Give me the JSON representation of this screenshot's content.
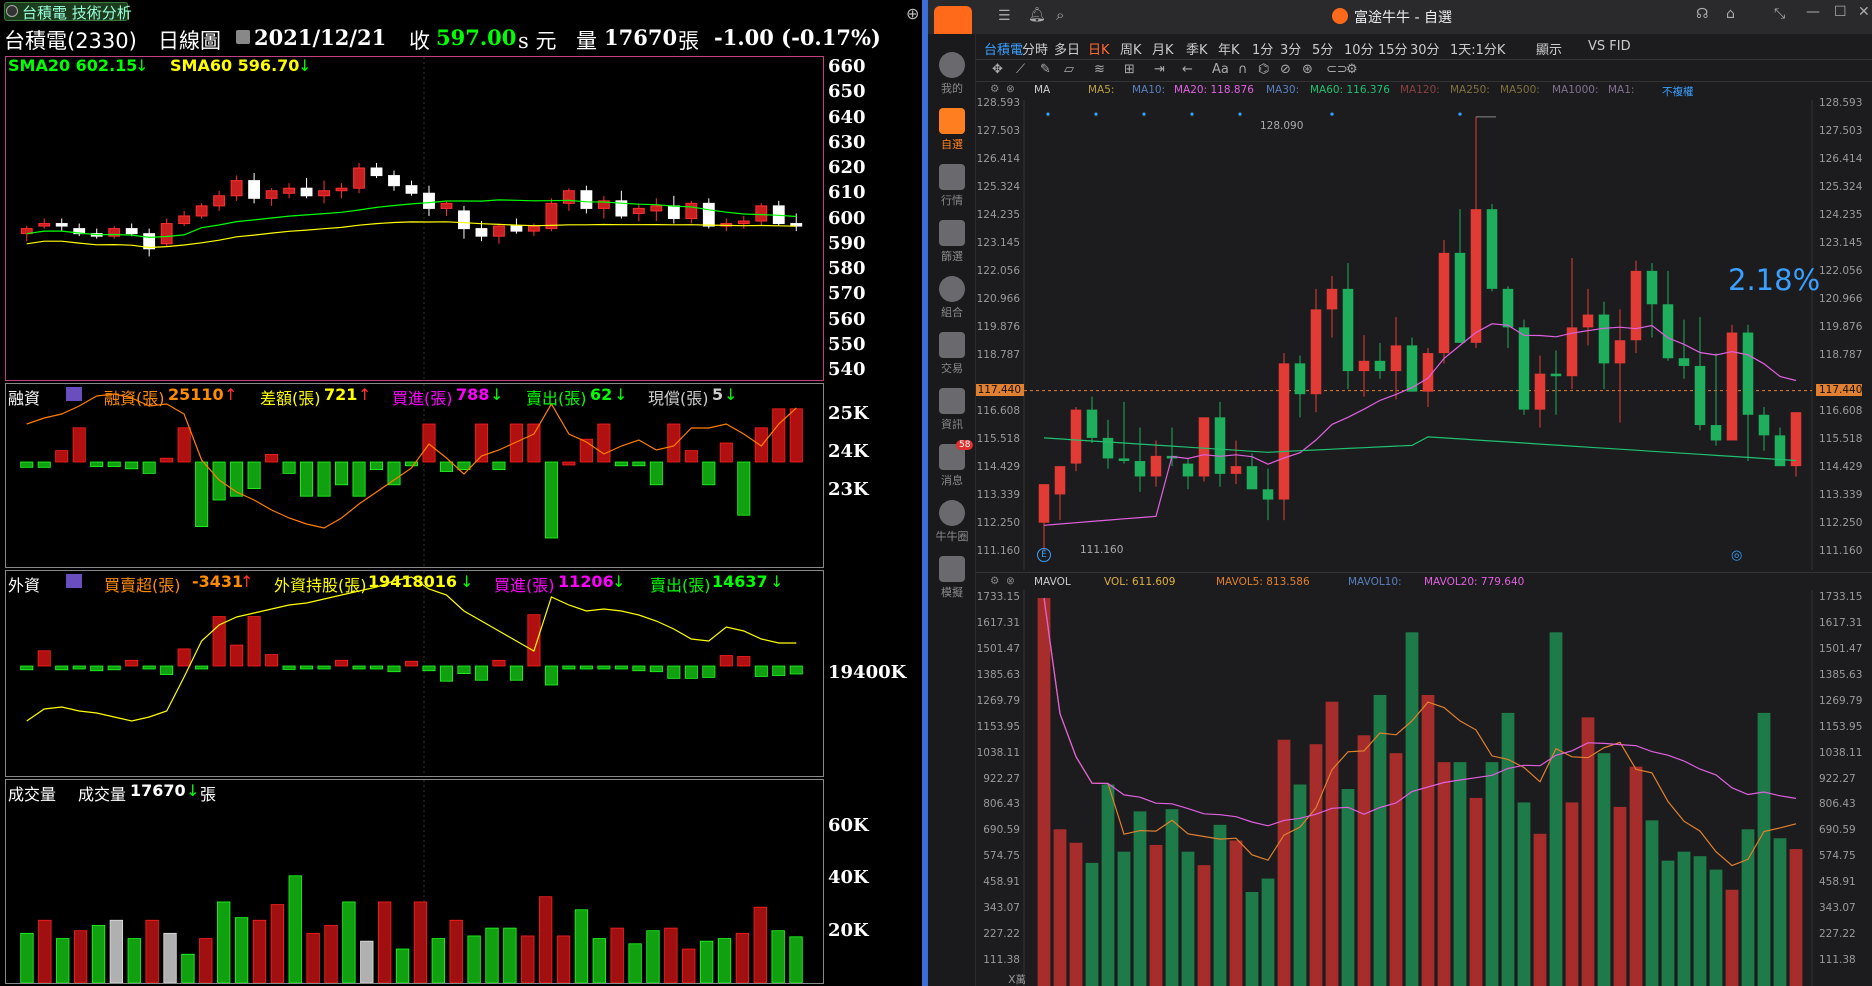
{
  "left": {
    "tab_title": "台積電 技術分析",
    "header": {
      "stock": "台積電(2330)",
      "period": "日線圖",
      "date": "2021/12/21",
      "close_label": "收",
      "close": "597.00",
      "close_unit": "s 元",
      "vol_label": "量",
      "vol": "17670",
      "vol_unit": "張",
      "change": "-1.00 (-0.17%)"
    },
    "price_panel": {
      "sma20": "SMA20 602.15",
      "sma60": "SMA60 596.70",
      "yticks": [
        "660",
        "650",
        "640",
        "630",
        "620",
        "610",
        "600",
        "590",
        "580",
        "570",
        "560",
        "550",
        "540"
      ]
    },
    "margin_panel": {
      "title": "融資",
      "f1l": "融資(張)",
      "f1v": "25110",
      "f2l": "差額(張)",
      "f2v": "721",
      "f3l": "買進(張)",
      "f3v": "788",
      "f4l": "賣出(張)",
      "f4v": "62",
      "f5l": "現償(張)",
      "f5v": "5",
      "yticks": [
        "25K",
        "24K",
        "23K"
      ]
    },
    "foreign_panel": {
      "title": "外資",
      "f1l": "買賣超(張)",
      "f1v": "-3431",
      "f2l": "外資持股(張)",
      "f2v": "19418016",
      "f3l": "買進(張)",
      "f3v": "11206",
      "f4l": "賣出(張)",
      "f4v": "14637",
      "ytick": "19400K"
    },
    "volume_panel": {
      "title": "成交量",
      "vol_label": "成交量",
      "vol_value": "17670",
      "vol_unit": "張",
      "yticks": [
        "60K",
        "40K",
        "20K"
      ]
    }
  },
  "right": {
    "window_title": "富途牛牛 - 自選",
    "sidebar": [
      {
        "label": "我的",
        "icon": "user-icon"
      },
      {
        "label": "自選",
        "icon": "watchlist-icon"
      },
      {
        "label": "行情",
        "icon": "market-icon"
      },
      {
        "label": "篩選",
        "icon": "filter-icon"
      },
      {
        "label": "組合",
        "icon": "portfolio-icon"
      },
      {
        "label": "交易",
        "icon": "trade-icon"
      },
      {
        "label": "資訊",
        "icon": "news-icon"
      },
      {
        "label": "消息",
        "icon": "message-icon",
        "badge": "58"
      },
      {
        "label": "牛牛圈",
        "icon": "community-icon"
      },
      {
        "label": "模擬",
        "icon": "simulate-icon"
      }
    ],
    "tabs": [
      "台積電",
      "分時",
      "多日",
      "日K",
      "周K",
      "月K",
      "季K",
      "年K",
      "1分",
      "3分",
      "5分",
      "10分",
      "15分",
      "30分",
      "1天:1分K",
      "顯示",
      "VS FID"
    ],
    "ma_bar": {
      "ma": "MA",
      "ma5": "MA5:",
      "ma10": "MA10:",
      "ma20": "MA20: 118.876",
      "ma30": "MA30:",
      "ma60": "MA60: 116.376",
      "ma120": "MA120:",
      "ma250": "MA250:",
      "ma500": "MA500:",
      "ma1000": "MA1000:",
      "ma1": "MA1:",
      "adj": "不複權"
    },
    "price_yticks": [
      "128.593",
      "127.503",
      "126.414",
      "125.324",
      "124.235",
      "123.145",
      "122.056",
      "120.966",
      "119.876",
      "118.787",
      "117.440",
      "116.608",
      "115.518",
      "114.429",
      "113.339",
      "112.250",
      "111.160"
    ],
    "current_price": "117.440",
    "high_label": "128.090",
    "low_label": "111.160",
    "percent": "2.18%",
    "vol_bar": {
      "label": "MAVOL",
      "vol": "VOL: 611.609",
      "mavol5": "MAVOL5: 813.586",
      "mavol10": "MAVOL10:",
      "mavol20": "MAVOL20: 779.640"
    },
    "vol_yticks": [
      "1733.15",
      "1617.31",
      "1501.47",
      "1385.63",
      "1269.79",
      "1153.95",
      "1038.11",
      "922.27",
      "806.43",
      "690.59",
      "574.75",
      "458.91",
      "343.07",
      "227.22",
      "111.38"
    ],
    "vol_unit": "X萬"
  },
  "colors": {
    "up_red": "#c0302b",
    "down_green": "#1f9a54",
    "sma20": "#00ff00",
    "sma60": "#ffff00",
    "accent_blue": "#3aa0ff"
  },
  "chart_data": [
    {
      "type": "candlestick",
      "title": "台積電 技術分析 日線圖",
      "ylim": [
        540,
        660
      ],
      "series": [
        {
          "name": "SMA20",
          "last": 602.15
        },
        {
          "name": "SMA60",
          "last": 596.7
        }
      ],
      "ohlc": [
        [
          594,
          597,
          591,
          596
        ],
        [
          597,
          600,
          596,
          598
        ],
        [
          598,
          600,
          595,
          597
        ],
        [
          596,
          598,
          593,
          594
        ],
        [
          594,
          596,
          592,
          593
        ],
        [
          593,
          597,
          592,
          596
        ],
        [
          596,
          598,
          593,
          594
        ],
        [
          594,
          596,
          585,
          588
        ],
        [
          590,
          600,
          589,
          598
        ],
        [
          598,
          603,
          597,
          601
        ],
        [
          601,
          606,
          600,
          605
        ],
        [
          605,
          611,
          603,
          609
        ],
        [
          609,
          617,
          607,
          615
        ],
        [
          615,
          618,
          606,
          608
        ],
        [
          608,
          612,
          605,
          611
        ],
        [
          610,
          614,
          608,
          612
        ],
        [
          612,
          616,
          608,
          609
        ],
        [
          609,
          615,
          606,
          611
        ],
        [
          611,
          614,
          608,
          612
        ],
        [
          612,
          622,
          610,
          620
        ],
        [
          620,
          622,
          616,
          617
        ],
        [
          617,
          619,
          611,
          613
        ],
        [
          613,
          615,
          609,
          610
        ],
        [
          610,
          613,
          601,
          604
        ],
        [
          604,
          607,
          601,
          606
        ],
        [
          603,
          605,
          592,
          596
        ],
        [
          596,
          599,
          591,
          593
        ],
        [
          593,
          598,
          590,
          597
        ],
        [
          597,
          600,
          594,
          595
        ],
        [
          595,
          598,
          593,
          597
        ],
        [
          596,
          608,
          595,
          606
        ],
        [
          606,
          612,
          603,
          611
        ],
        [
          611,
          613,
          602,
          604
        ],
        [
          604,
          609,
          600,
          607
        ],
        [
          607,
          611,
          600,
          601
        ],
        [
          602,
          606,
          599,
          604
        ],
        [
          603,
          608,
          599,
          605
        ],
        [
          605,
          609,
          598,
          600
        ],
        [
          600,
          607,
          598,
          606
        ],
        [
          606,
          608,
          596,
          597
        ],
        [
          597,
          600,
          595,
          598
        ],
        [
          598,
          601,
          596,
          599
        ],
        [
          599,
          606,
          597,
          605
        ],
        [
          605,
          607,
          597,
          598
        ],
        [
          598,
          602,
          595,
          597
        ]
      ]
    },
    {
      "type": "bar",
      "title": "融資",
      "yticks": [
        "25K",
        "24K",
        "23K"
      ],
      "values": [
        -140,
        -140,
        300,
        900,
        -120,
        -120,
        -180,
        -300,
        100,
        900,
        -1700,
        -1000,
        -900,
        -700,
        200,
        -300,
        -900,
        -900,
        -600,
        -900,
        -200,
        -600,
        -100,
        1000,
        -250,
        -200,
        1000,
        -200,
        1000,
        1000,
        -2000,
        0,
        600,
        1000,
        -100,
        -100,
        -600,
        1000,
        300,
        -600,
        500,
        -1400,
        900,
        1400,
        1400
      ],
      "series": [
        {
          "name": "融資(張)",
          "last": 25110
        }
      ]
    },
    {
      "type": "bar",
      "title": "外資",
      "yticks": [
        "19400K"
      ],
      "values": [
        -200,
        800,
        -200,
        -150,
        -250,
        -200,
        300,
        -150,
        -450,
        900,
        -100,
        2600,
        1100,
        2600,
        600,
        -180,
        -150,
        -150,
        300,
        -50,
        -150,
        -300,
        250,
        -250,
        -800,
        -400,
        -750,
        300,
        -750,
        2700,
        -1000,
        -100,
        -150,
        -100,
        -100,
        -250,
        -300,
        -650,
        -650,
        -600,
        550,
        500,
        -550,
        -500,
        -420
      ],
      "series": [
        {
          "name": "外資持股(張)",
          "last": 19418016
        }
      ]
    },
    {
      "type": "bar",
      "title": "成交量",
      "yticks": [
        "60K",
        "40K",
        "20K"
      ],
      "values": [
        19000,
        24000,
        17000,
        20000,
        22000,
        24000,
        17000,
        24000,
        19000,
        11000,
        17000,
        31000,
        25000,
        24000,
        30000,
        41000,
        19000,
        22000,
        31000,
        16000,
        31000,
        13000,
        31000,
        17000,
        24000,
        18000,
        21000,
        21000,
        18000,
        33000,
        18000,
        28000,
        17000,
        21000,
        15000,
        20000,
        21000,
        13000,
        16000,
        17000,
        19000,
        29000,
        20000,
        17670
      ],
      "series": [
        {
          "name": "成交量",
          "last": 17670
        }
      ]
    },
    {
      "type": "candlestick",
      "title": "富途牛牛 日K",
      "ylim": [
        111.16,
        128.593
      ],
      "series": [
        {
          "name": "MA20",
          "last": 118.876
        },
        {
          "name": "MA60",
          "last": 116.376
        }
      ],
      "ohlc": [
        [
          112.3,
          113.8,
          111.2,
          113.8
        ],
        [
          113.4,
          114.5,
          112.4,
          114.5
        ],
        [
          114.6,
          116.8,
          114.3,
          116.7
        ],
        [
          116.7,
          117.2,
          115.4,
          115.6
        ],
        [
          115.6,
          116.3,
          114.4,
          114.8
        ],
        [
          114.8,
          117.0,
          114.6,
          114.7
        ],
        [
          114.7,
          116.0,
          113.5,
          114.1
        ],
        [
          114.1,
          115.5,
          113.7,
          114.9
        ],
        [
          114.9,
          116.0,
          114.5,
          114.8
        ],
        [
          114.6,
          114.8,
          113.6,
          114.1
        ],
        [
          114.1,
          115.2,
          113.9,
          116.4
        ],
        [
          116.4,
          117.0,
          113.7,
          114.2
        ],
        [
          114.2,
          115.5,
          113.8,
          114.5
        ],
        [
          114.5,
          115.0,
          113.6,
          113.6
        ],
        [
          113.6,
          114.4,
          112.4,
          113.2
        ],
        [
          113.2,
          118.9,
          112.4,
          118.5
        ],
        [
          118.5,
          118.8,
          116.4,
          117.3
        ],
        [
          117.3,
          121.4,
          116.6,
          120.6
        ],
        [
          120.6,
          121.9,
          119.5,
          121.4
        ],
        [
          121.4,
          122.4,
          117.5,
          118.2
        ],
        [
          118.2,
          119.6,
          117.2,
          118.6
        ],
        [
          118.6,
          119.3,
          117.9,
          118.2
        ],
        [
          118.2,
          120.3,
          117.1,
          119.2
        ],
        [
          119.2,
          119.5,
          117.4,
          117.4
        ],
        [
          117.4,
          119.1,
          116.8,
          118.9
        ],
        [
          118.9,
          123.3,
          118.5,
          122.8
        ],
        [
          122.8,
          124.5,
          119.3,
          119.3
        ],
        [
          119.3,
          128.1,
          119.1,
          124.5
        ],
        [
          124.5,
          124.7,
          121.3,
          121.4
        ],
        [
          121.4,
          121.5,
          119.1,
          119.9
        ],
        [
          119.9,
          120.2,
          116.5,
          116.7
        ],
        [
          116.7,
          118.8,
          116.0,
          118.1
        ],
        [
          118.1,
          119.0,
          116.5,
          118.0
        ],
        [
          118.0,
          122.6,
          117.5,
          119.9
        ],
        [
          119.9,
          121.4,
          119.2,
          120.4
        ],
        [
          120.4,
          120.9,
          117.5,
          118.5
        ],
        [
          118.5,
          120.6,
          116.2,
          119.4
        ],
        [
          119.4,
          122.5,
          118.9,
          122.1
        ],
        [
          122.1,
          122.4,
          119.5,
          120.8
        ],
        [
          120.8,
          122.1,
          118.6,
          118.7
        ],
        [
          118.7,
          120.2,
          117.9,
          118.4
        ],
        [
          118.4,
          120.3,
          115.9,
          116.1
        ],
        [
          116.1,
          118.9,
          115.3,
          115.5
        ],
        [
          115.5,
          120.0,
          115.6,
          119.7
        ],
        [
          119.7,
          120.0,
          114.7,
          116.5
        ],
        [
          116.5,
          116.8,
          115.1,
          115.7
        ],
        [
          115.7,
          116.0,
          114.5,
          114.5
        ],
        [
          114.5,
          116.6,
          114.1,
          116.6
        ]
      ]
    },
    {
      "type": "bar",
      "title": "MAVOL",
      "yticks": [
        "1733.15",
        "111.38"
      ],
      "values": [
        1733,
        700,
        640,
        550,
        900,
        600,
        780,
        630,
        790,
        600,
        540,
        720,
        650,
        420,
        480,
        1100,
        900,
        1080,
        1270,
        880,
        1120,
        1300,
        1040,
        1580,
        1300,
        1000,
        1000,
        840,
        1000,
        1220,
        820,
        680,
        1580,
        820,
        1200,
        1040,
        800,
        980,
        740,
        560,
        600,
        580,
        520,
        430,
        700,
        1220,
        660,
        611.6
      ],
      "series": [
        {
          "name": "MAVOL5",
          "last": 813.586
        },
        {
          "name": "MAVOL20",
          "last": 779.64
        }
      ]
    }
  ]
}
